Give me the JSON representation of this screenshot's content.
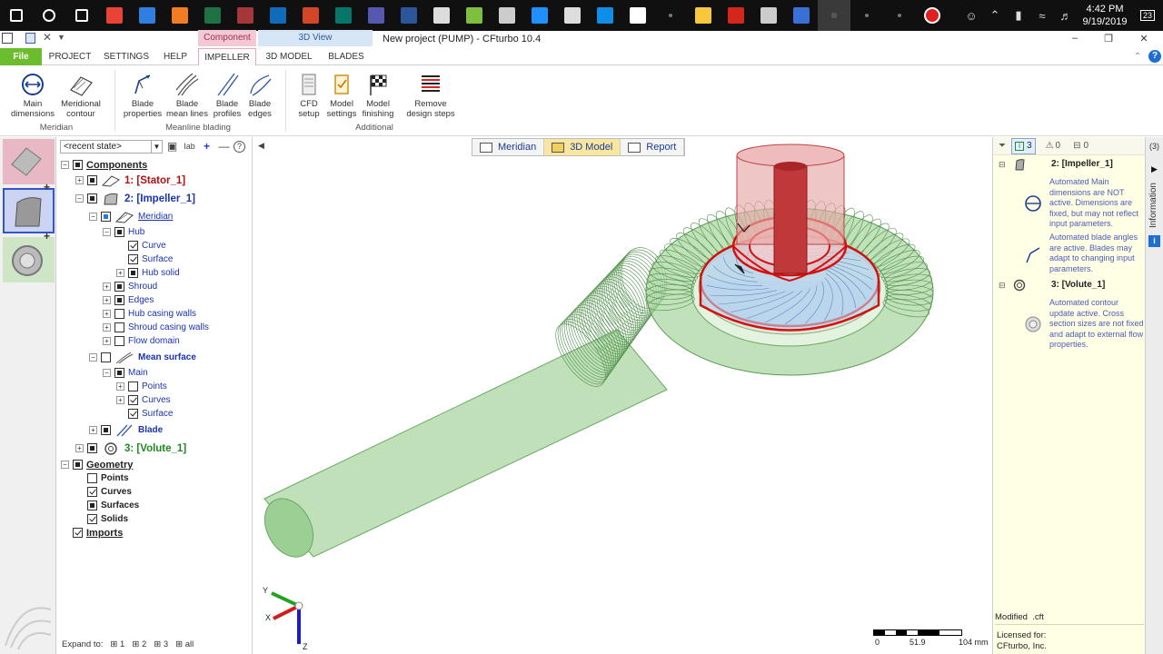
{
  "taskbar": {
    "apps": [
      {
        "name": "windows-start-icon",
        "color": "#ffffff"
      },
      {
        "name": "cortana-icon",
        "color": "#ffffff"
      },
      {
        "name": "task-view-icon",
        "color": "#ffffff"
      },
      {
        "name": "chrome-icon",
        "color": "#e84335"
      },
      {
        "name": "edge-icon",
        "color": "#2f7fe0"
      },
      {
        "name": "firefox-icon",
        "color": "#f27c22"
      },
      {
        "name": "excel-icon",
        "color": "#1e7145"
      },
      {
        "name": "access-icon",
        "color": "#a4373a"
      },
      {
        "name": "outlook-icon",
        "color": "#0f6cbd"
      },
      {
        "name": "powerpoint-icon",
        "color": "#d24726"
      },
      {
        "name": "publisher-icon",
        "color": "#077568"
      },
      {
        "name": "teams-icon",
        "color": "#5558af"
      },
      {
        "name": "word-icon",
        "color": "#2b579a"
      },
      {
        "name": "calculator-icon",
        "color": "#dddddd"
      },
      {
        "name": "notepad-icon",
        "color": "#7fbf3f"
      },
      {
        "name": "paint-icon",
        "color": "#cccccc"
      },
      {
        "name": "onedrive-icon",
        "color": "#1e90ff"
      },
      {
        "name": "display-icon",
        "color": "#dddddd"
      },
      {
        "name": "teamviewer-icon",
        "color": "#0e8ee9"
      },
      {
        "name": "browser-icon",
        "color": "#ffffff"
      },
      {
        "name": "app-dot-icon",
        "color": "#333333"
      },
      {
        "name": "file-explorer-icon",
        "color": "#f7c83e"
      },
      {
        "name": "acrobat-icon",
        "color": "#d4261b"
      },
      {
        "name": "cloud-app-icon",
        "color": "#cccccc"
      },
      {
        "name": "network-app-icon",
        "color": "#3a6fd8"
      },
      {
        "name": "cfturbo-active-icon",
        "color": "#555555"
      },
      {
        "name": "app-dot-2-icon",
        "color": "#333333"
      },
      {
        "name": "app-dot-3-icon",
        "color": "#333333"
      },
      {
        "name": "record-icon",
        "color": "#e02020"
      }
    ],
    "time": "4:42 PM",
    "date": "9/19/2019",
    "notifications": "23"
  },
  "window": {
    "title": "New project (PUMP) - CFturbo 10.4",
    "context_component": "Component",
    "context_3dview": "3D View"
  },
  "ribbon": {
    "tabs": [
      "File",
      "PROJECT",
      "SETTINGS",
      "HELP",
      "IMPELLER",
      "3D MODEL",
      "BLADES"
    ],
    "groups": [
      {
        "label": "Meridian"
      },
      {
        "label": "Meanline blading"
      },
      {
        "label": "Additional"
      }
    ],
    "buttons": [
      {
        "line1": "Main",
        "line2": "dimensions"
      },
      {
        "line1": "Meridional",
        "line2": "contour"
      },
      {
        "line1": "Blade",
        "line2": "properties"
      },
      {
        "line1": "Blade",
        "line2": "mean lines"
      },
      {
        "line1": "Blade",
        "line2": "profiles"
      },
      {
        "line1": "Blade",
        "line2": "edges"
      },
      {
        "line1": "CFD",
        "line2": "setup"
      },
      {
        "line1": "Model",
        "line2": "settings"
      },
      {
        "line1": "Model",
        "line2": "finishing"
      },
      {
        "line1": "Remove",
        "line2": "design steps"
      }
    ]
  },
  "tree": {
    "state": "<recent state>",
    "items": [
      {
        "label": "Components"
      },
      {
        "label": "1: [Stator_1]"
      },
      {
        "label": "2: [Impeller_1]"
      },
      {
        "label": "Meridian"
      },
      {
        "label": "Hub"
      },
      {
        "label": "Curve"
      },
      {
        "label": "Surface"
      },
      {
        "label": "Hub solid"
      },
      {
        "label": "Shroud"
      },
      {
        "label": "Edges"
      },
      {
        "label": "Hub casing walls"
      },
      {
        "label": "Shroud casing walls"
      },
      {
        "label": "Flow domain"
      },
      {
        "label": "Mean surface"
      },
      {
        "label": "Main"
      },
      {
        "label": "Points"
      },
      {
        "label": "Curves"
      },
      {
        "label": "Surface"
      },
      {
        "label": "Blade"
      },
      {
        "label": "3: [Volute_1]"
      },
      {
        "label": "Geometry"
      },
      {
        "label": "Points"
      },
      {
        "label": "Curves"
      },
      {
        "label": "Surfaces"
      },
      {
        "label": "Solids"
      },
      {
        "label": "Imports"
      }
    ],
    "expand_label": "Expand to:",
    "expand_levels": [
      "1",
      "2",
      "3",
      "all"
    ]
  },
  "view": {
    "tabs": [
      "Meridian",
      "3D Model",
      "Report"
    ],
    "axis_y": "Y",
    "axis_x": "X",
    "axis_z": "Z",
    "scale_ticks": [
      "0",
      "51.9",
      "104 mm"
    ]
  },
  "info": {
    "count_info": "3",
    "count_warn": "0",
    "count_hidden": "0",
    "total": "(3)",
    "entries": [
      {
        "title": "2: [Impeller_1]",
        "notes": [
          "Automated Main dimensions are NOT active. Dimensions are fixed, but may not reflect input parameters.",
          "Automated blade angles are active. Blades may adapt to changing input parameters."
        ]
      },
      {
        "title": "3: [Volute_1]",
        "notes": [
          "Automated contour update active. Cross section sizes are not fixed and adapt to external flow properties."
        ]
      }
    ],
    "modified": "Modified",
    "file_ext": ".cft",
    "licensed_label": "Licensed for:",
    "licensee": "CFturbo, Inc.",
    "sidebar_label": "Information"
  }
}
